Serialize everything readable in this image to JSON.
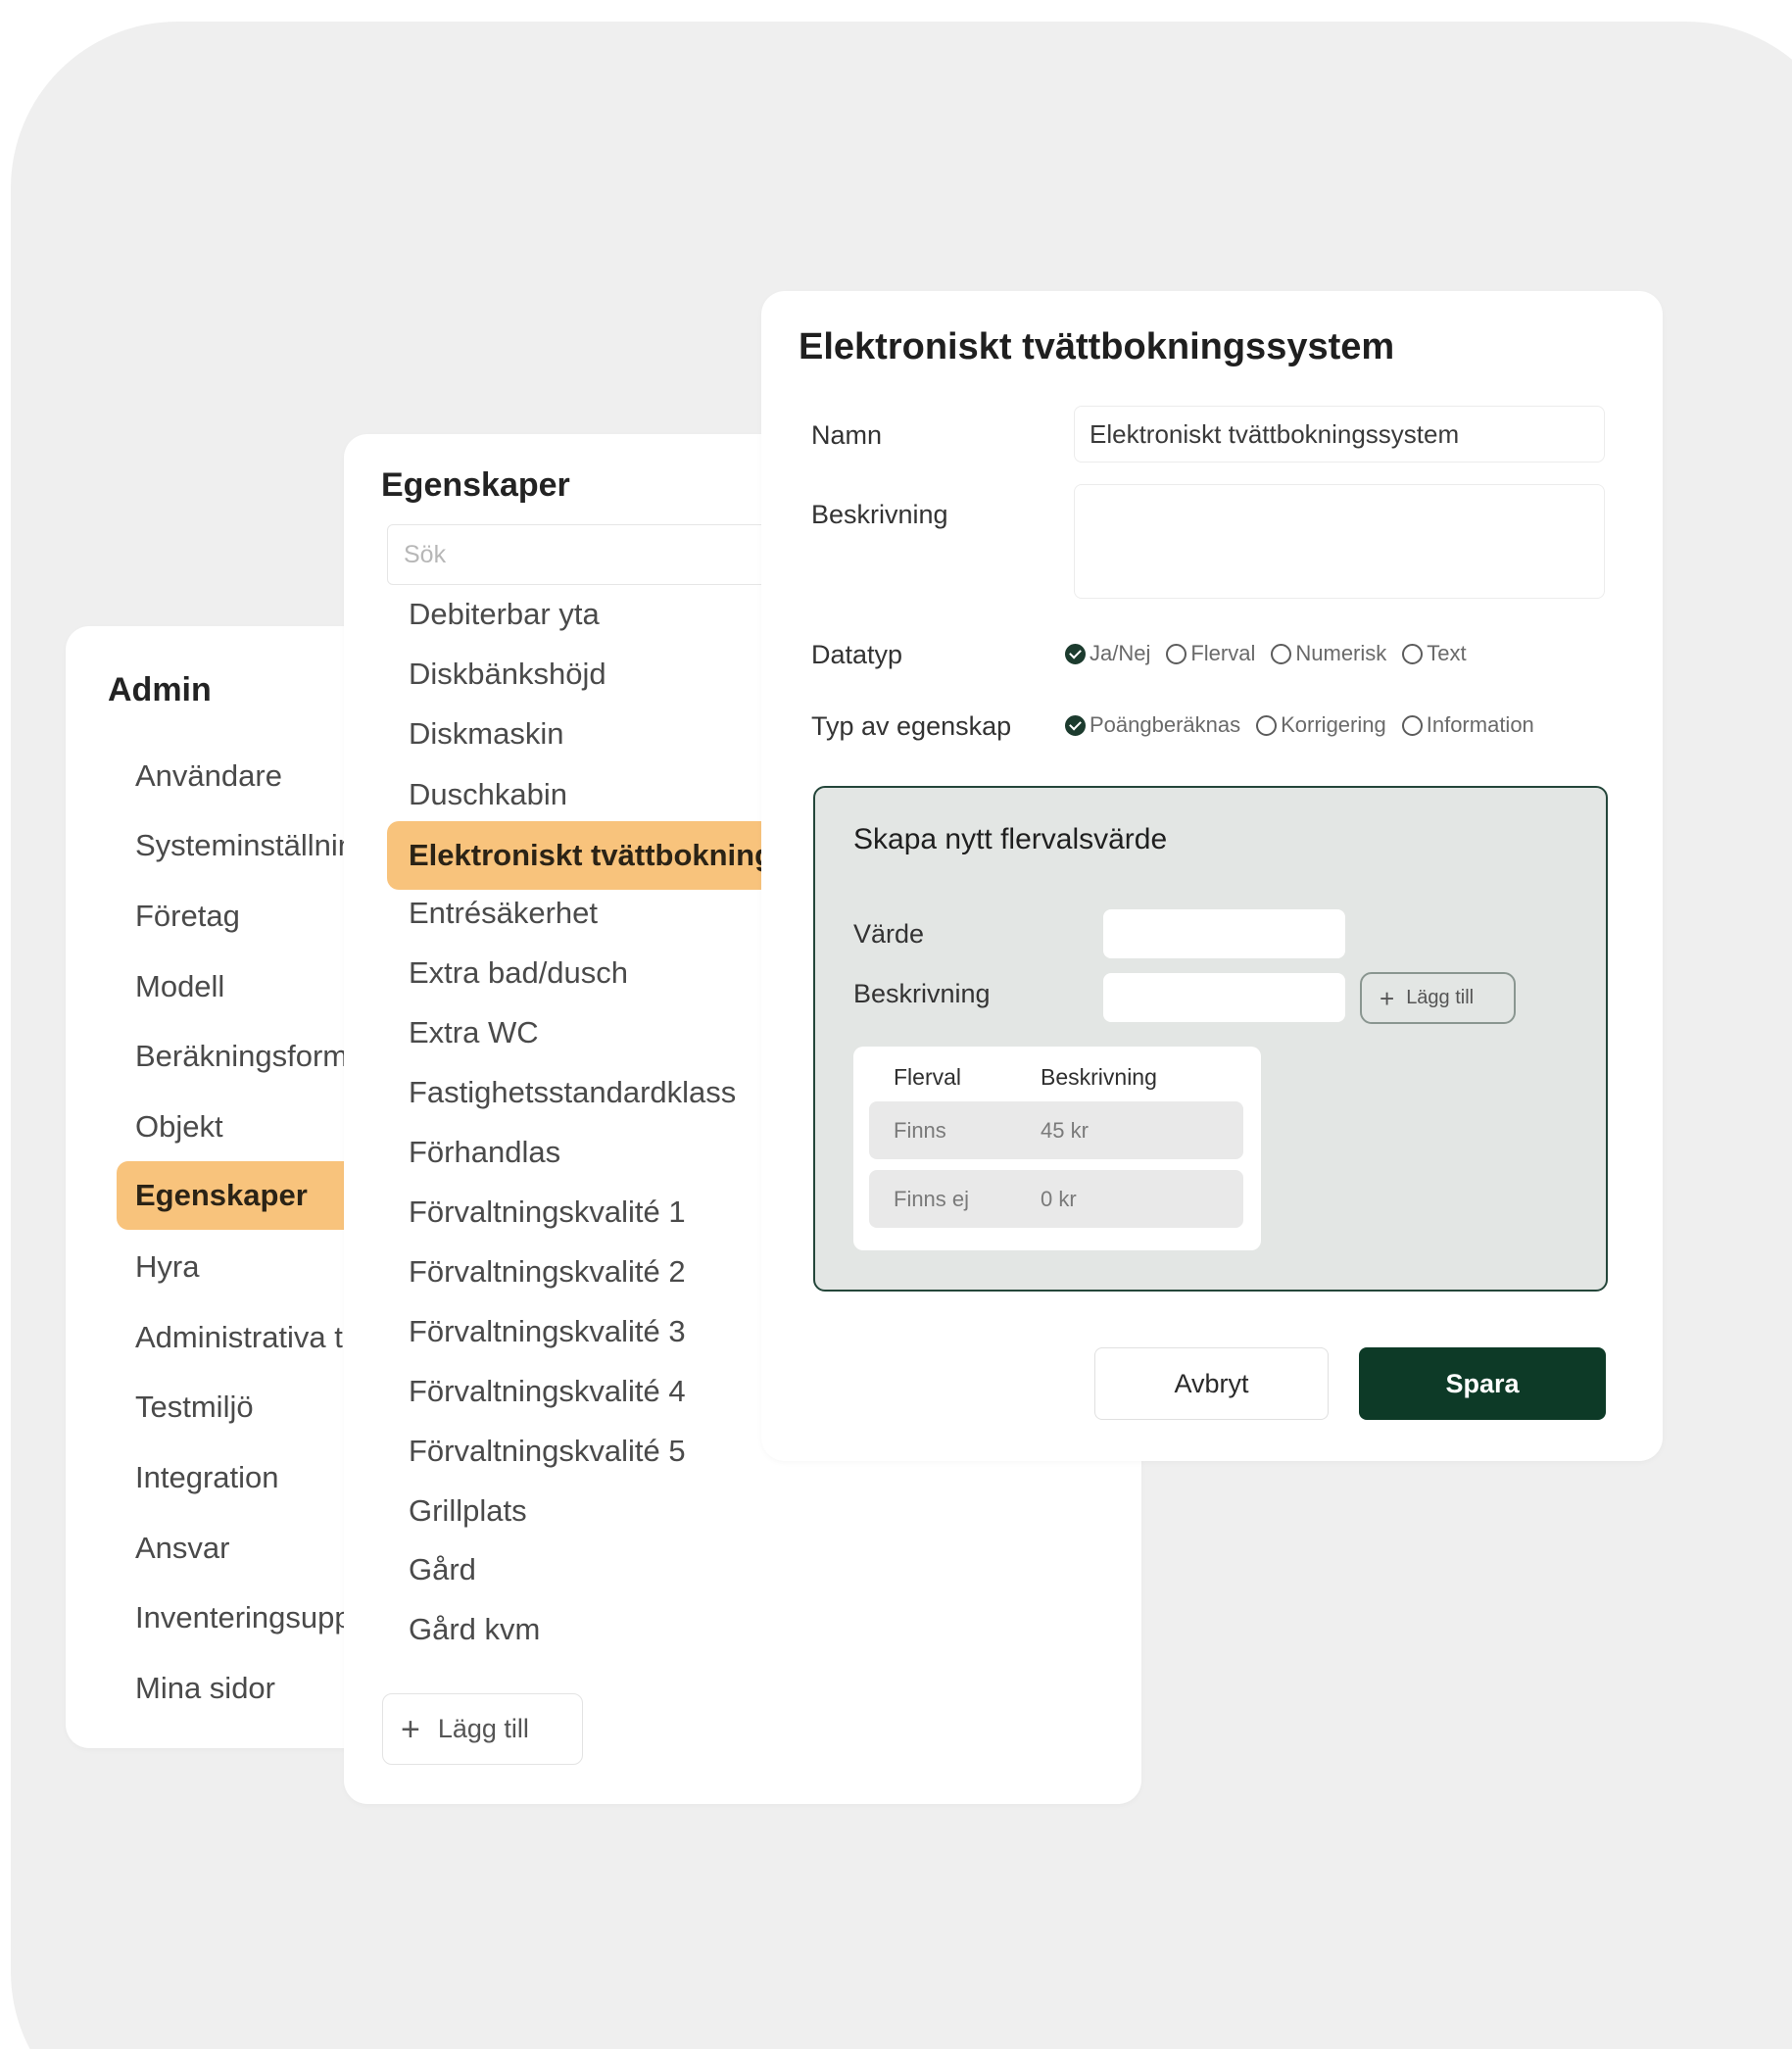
{
  "admin": {
    "title": "Admin",
    "items": [
      {
        "label": "Användare"
      },
      {
        "label": "Systeminställningar"
      },
      {
        "label": "Företag"
      },
      {
        "label": "Modell"
      },
      {
        "label": "Beräkningsformler"
      },
      {
        "label": "Objekt"
      },
      {
        "label": "Egenskaper"
      },
      {
        "label": "Hyra"
      },
      {
        "label": "Administrativa tillägg"
      },
      {
        "label": "Testmiljö"
      },
      {
        "label": "Integration"
      },
      {
        "label": "Ansvar"
      },
      {
        "label": "Inventeringsuppgifter"
      },
      {
        "label": "Mina sidor"
      }
    ],
    "active_index": 6
  },
  "properties": {
    "title": "Egenskaper",
    "search_placeholder": "Sök",
    "items": [
      {
        "label": "Debiterbar yta"
      },
      {
        "label": "Diskbänkshöjd"
      },
      {
        "label": "Diskmaskin"
      },
      {
        "label": "Duschkabin"
      },
      {
        "label": "Elektroniskt tvättbokningssystem"
      },
      {
        "label": "Entrésäkerhet"
      },
      {
        "label": "Extra bad/dusch"
      },
      {
        "label": "Extra WC"
      },
      {
        "label": "Fastighetsstandardklass"
      },
      {
        "label": "Förhandlas"
      },
      {
        "label": "Förvaltningskvalité 1"
      },
      {
        "label": "Förvaltningskvalité 2"
      },
      {
        "label": "Förvaltningskvalité 3"
      },
      {
        "label": "Förvaltningskvalité 4"
      },
      {
        "label": "Förvaltningskvalité 5"
      },
      {
        "label": "Grillplats"
      },
      {
        "label": "Gård"
      },
      {
        "label": "Gård kvm"
      }
    ],
    "active_index": 4,
    "add_label": "Lägg till"
  },
  "detail": {
    "title": "Elektroniskt tvättbokningssystem",
    "name_label": "Namn",
    "name_value": "Elektroniskt tvättbokningssystem",
    "description_label": "Beskrivning",
    "description_value": "",
    "datatype_label": "Datatyp",
    "datatype_options": [
      {
        "label": "Ja/Nej",
        "checked": true
      },
      {
        "label": "Flerval",
        "checked": false
      },
      {
        "label": "Numerisk",
        "checked": false
      },
      {
        "label": "Text",
        "checked": false
      }
    ],
    "proptype_label": "Typ av egenskap",
    "proptype_options": [
      {
        "label": "Poängberäknas",
        "checked": true
      },
      {
        "label": "Korrigering",
        "checked": false
      },
      {
        "label": "Information",
        "checked": false
      }
    ],
    "multivalue": {
      "title": "Skapa nytt flervalsvärde",
      "value_label": "Värde",
      "description_label": "Beskrivning",
      "add_label": "Lägg till",
      "columns": [
        "Flerval",
        "Beskrivning"
      ],
      "rows": [
        {
          "value": "Finns",
          "description": "45 kr"
        },
        {
          "value": "Finns ej",
          "description": "0 kr"
        }
      ]
    },
    "cancel_label": "Avbryt",
    "save_label": "Spara"
  },
  "colors": {
    "backdrop": "#efefef",
    "highlight": "#f8c37c",
    "primary": "#0d3a27",
    "multivalue_bg": "#e3e6e4",
    "multivalue_border": "#24463a"
  },
  "icons": {
    "add": "plus-icon",
    "radio_checked": "radio-checked-icon",
    "radio_unchecked": "radio-unchecked-icon"
  }
}
